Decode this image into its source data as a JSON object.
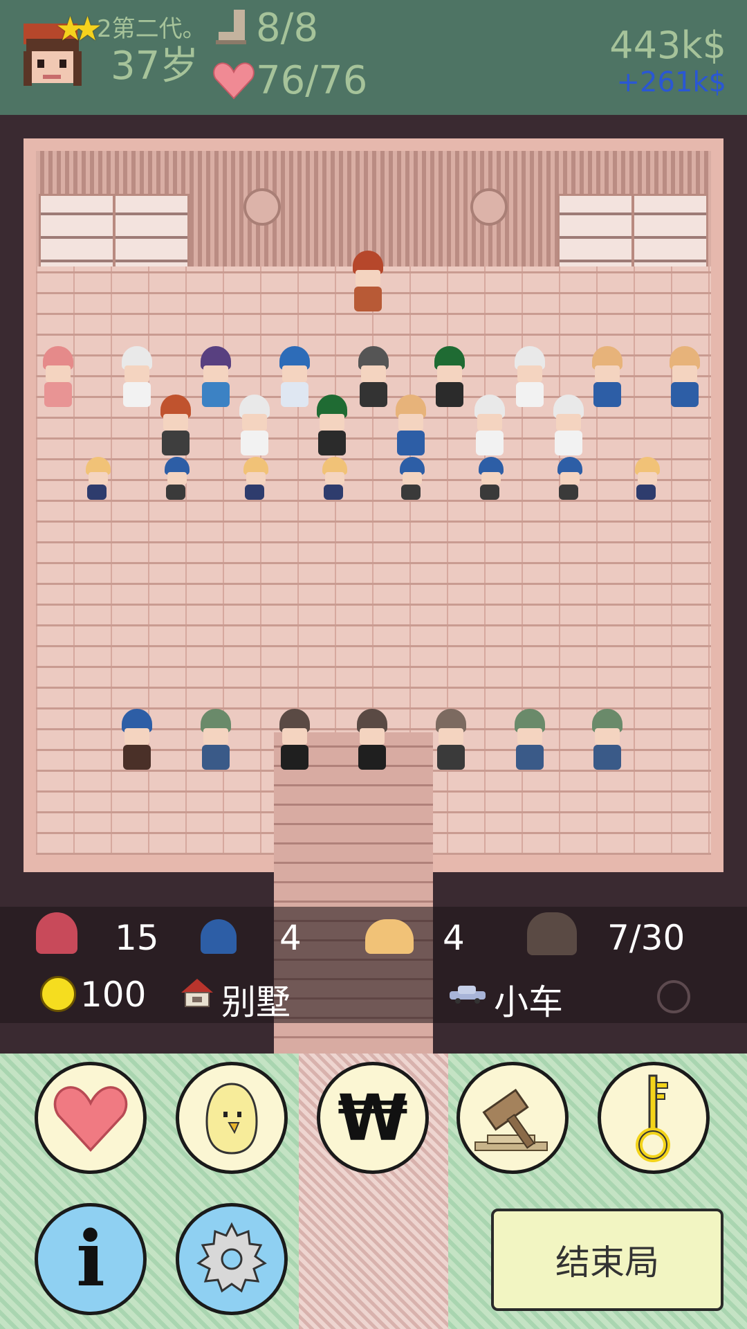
{
  "header": {
    "generation": "2第二代。",
    "age": "37岁",
    "energy": "8/8",
    "health": "76/76",
    "money": "443k$",
    "income": "+261k$",
    "stars": 2
  },
  "stats": {
    "wives_count": "15",
    "sons_count": "4",
    "daughters_count": "4",
    "maids_count": "7/30",
    "happiness": "100",
    "housing": "别墅",
    "vehicle": "小车"
  },
  "actions": {
    "end_turn_label": "结束局",
    "info_label": "i",
    "money_label": "₩"
  },
  "colors": {
    "topbar": "#4e7464",
    "header_text": "#a6c39a",
    "income_text": "#2a57d4",
    "button_fill": "#fbf6d3",
    "blue_button_fill": "#8fd0f2"
  },
  "icons": [
    "star-icon",
    "boot-icon",
    "heart-icon",
    "smile-icon",
    "house-icon",
    "car-icon",
    "gear-icon",
    "chick-icon",
    "gavel-icon",
    "key-icon",
    "info-icon"
  ]
}
